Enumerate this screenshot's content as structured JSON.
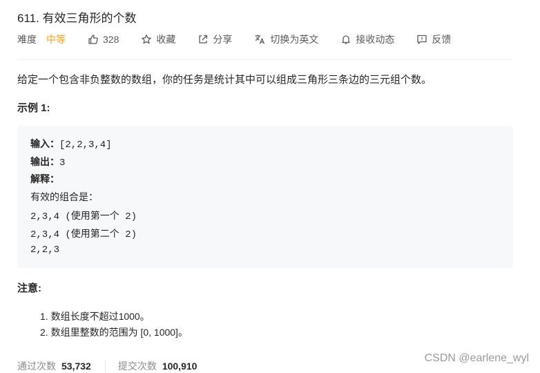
{
  "problem": {
    "title": "611. 有效三角形的个数"
  },
  "toolbar": {
    "difficulty_label": "难度",
    "difficulty_value": "中等",
    "like_count": "328",
    "collect_label": "收藏",
    "share_label": "分享",
    "translate_label": "切换为英文",
    "follow_label": "接收动态",
    "feedback_label": "反馈",
    "accent_color": "#ffa116"
  },
  "content": {
    "description": "给定一个包含非负整数的数组，你的任务是统计其中可以组成三角形三条边的三元组个数。",
    "example_heading": "示例 1:",
    "example": {
      "input_key": "输入：",
      "input_value": "[2,2,3,4]",
      "output_key": "输出：",
      "output_value": "3",
      "explain_key": "解释：",
      "explain_line": "有效的组合是：",
      "combos": [
        "2,3,4 (使用第一个 2)",
        "2,3,4 (使用第二个 2)",
        "2,2,3"
      ]
    },
    "note_heading": "注意:",
    "notes": [
      "1. 数组长度不超过1000。",
      "2. 数组里整数的范围为 [0, 1000]。"
    ]
  },
  "stats": {
    "accepted_label": "通过次数",
    "accepted_value": "53,732",
    "submitted_label": "提交次数",
    "submitted_value": "100,910"
  },
  "watermark": "CSDN @earlene_wyl",
  "icons": [
    "thumbs-up-icon",
    "star-icon",
    "share-icon",
    "translate-icon",
    "bell-icon",
    "feedback-icon"
  ]
}
